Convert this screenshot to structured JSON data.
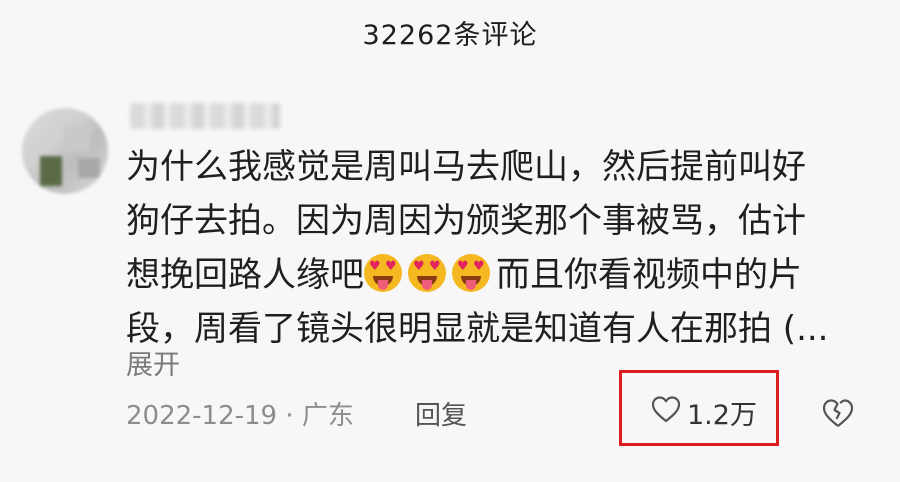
{
  "header": {
    "title": "32262条评论"
  },
  "comment": {
    "lines": [
      "为什么我感觉是周叫马去爬山，然后提前叫好",
      "狗仔去拍。因为周因为颁奖那个事被骂，估计",
      "想挽回路人缘吧",
      "而且你看视频中的片",
      "段，周看了镜头很明显就是知道有人在那拍 (..."
    ],
    "emoji_name": "heart-eyes-tongue-emoji",
    "emoji_count": 3,
    "expand_label": "展开",
    "meta": "2022-12-19 · 广东",
    "reply_label": "回复",
    "like_count": "1.2万"
  },
  "colors": {
    "background": "#f7f7f7",
    "highlight_border": "#d91e1e",
    "emoji_face": "#f5b820"
  },
  "icons": {
    "like": "heart-outline-icon",
    "dislike": "broken-heart-icon"
  }
}
